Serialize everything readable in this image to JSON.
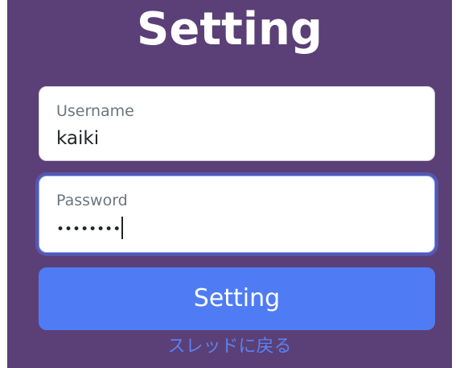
{
  "title": "Setting",
  "username": {
    "label": "Username",
    "value": "kaiki"
  },
  "password": {
    "label": "Password",
    "masked_value": "••••••••"
  },
  "submit_label": "Setting",
  "back_link_label": "スレッドに戻る",
  "colors": {
    "background": "#5b3f77",
    "button": "#4f7cf4",
    "link": "#5b82f0",
    "focus_ring": "#5276f5"
  }
}
